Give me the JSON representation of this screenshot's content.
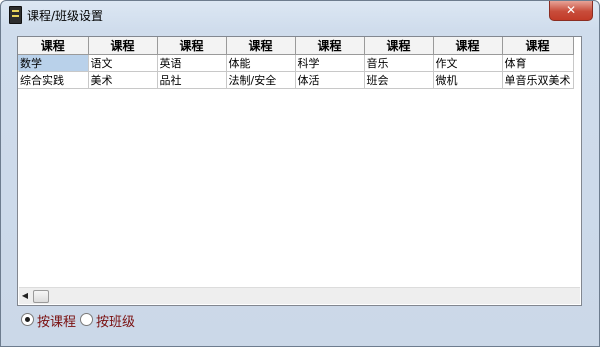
{
  "window": {
    "title": "课程/班级设置",
    "close_glyph": "✕"
  },
  "grid": {
    "headers": [
      "课程",
      "课程",
      "课程",
      "课程",
      "课程",
      "课程",
      "课程",
      "课程"
    ],
    "rows": [
      [
        "数学",
        "语文",
        "英语",
        "体能",
        "科学",
        "音乐",
        "作文",
        "体育"
      ],
      [
        "综合实践",
        "美术",
        "品社",
        "法制/安全",
        "体活",
        "班会",
        "微机",
        "单音乐双美术"
      ]
    ],
    "selected_cell": "数学"
  },
  "scrollbar": {
    "left_arrow": "◀"
  },
  "mode": {
    "options": [
      "按课程",
      "按班级"
    ],
    "selected": "按课程"
  }
}
